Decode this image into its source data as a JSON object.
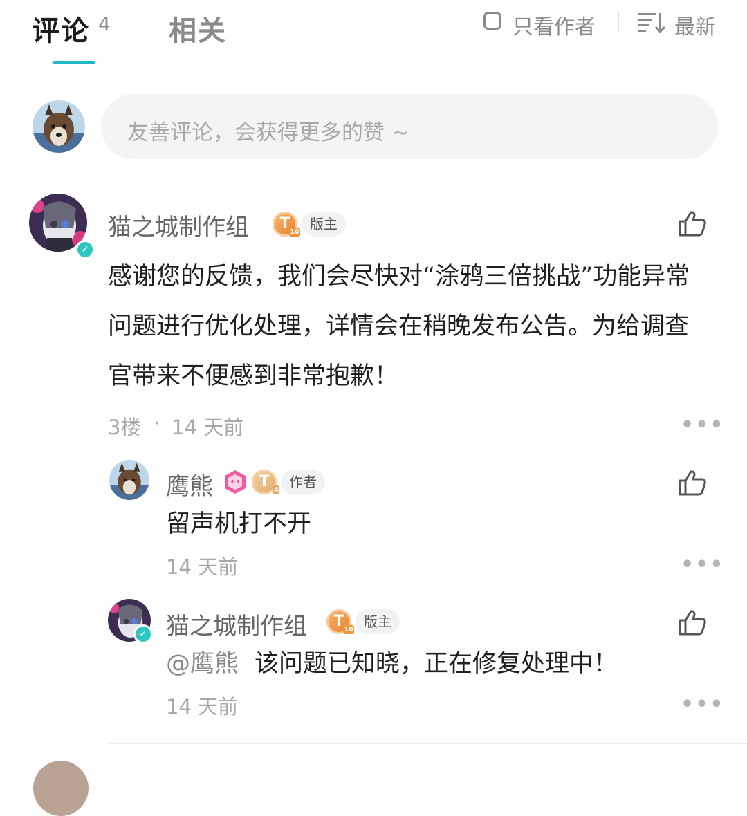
{
  "tabs": {
    "comments_label": "评论",
    "comments_count": "4",
    "related_label": "相关"
  },
  "controls": {
    "author_only_label": "只看作者",
    "sort_label": "最新",
    "sort_icon": "sort-icon"
  },
  "composer": {
    "placeholder": "友善评论，会获得更多的赞 ~"
  },
  "comments": [
    {
      "author": "猫之城制作组",
      "level_badge": "T",
      "level_num": "10",
      "role": "版主",
      "text_lines": [
        "感谢您的反馈，我们会尽快对“涂鸦三倍挑战”功能异常",
        "问题进行优化处理，详情会在稍晚发布公告。为给调查",
        "官带来不便感到非常抱歉！"
      ],
      "floor": "3楼",
      "separator": "·",
      "time": "14 天前",
      "replies": [
        {
          "author": "鹰熊",
          "level_badge": "T",
          "level_num": "4",
          "role": "作者",
          "text": "留声机打不开",
          "time": "14 天前"
        },
        {
          "author": "猫之城制作组",
          "level_badge": "T",
          "level_num": "10",
          "role": "版主",
          "mention": "@鹰熊",
          "text": "该问题已知晓，正在修复处理中！",
          "time": "14 天前"
        }
      ]
    }
  ],
  "more_glyph": "•••",
  "colors": {
    "accent": "#21b8c8",
    "badge_orange": "#ea7d2a",
    "badge_pink": "#f05aa0",
    "verified": "#2cc7c0"
  }
}
